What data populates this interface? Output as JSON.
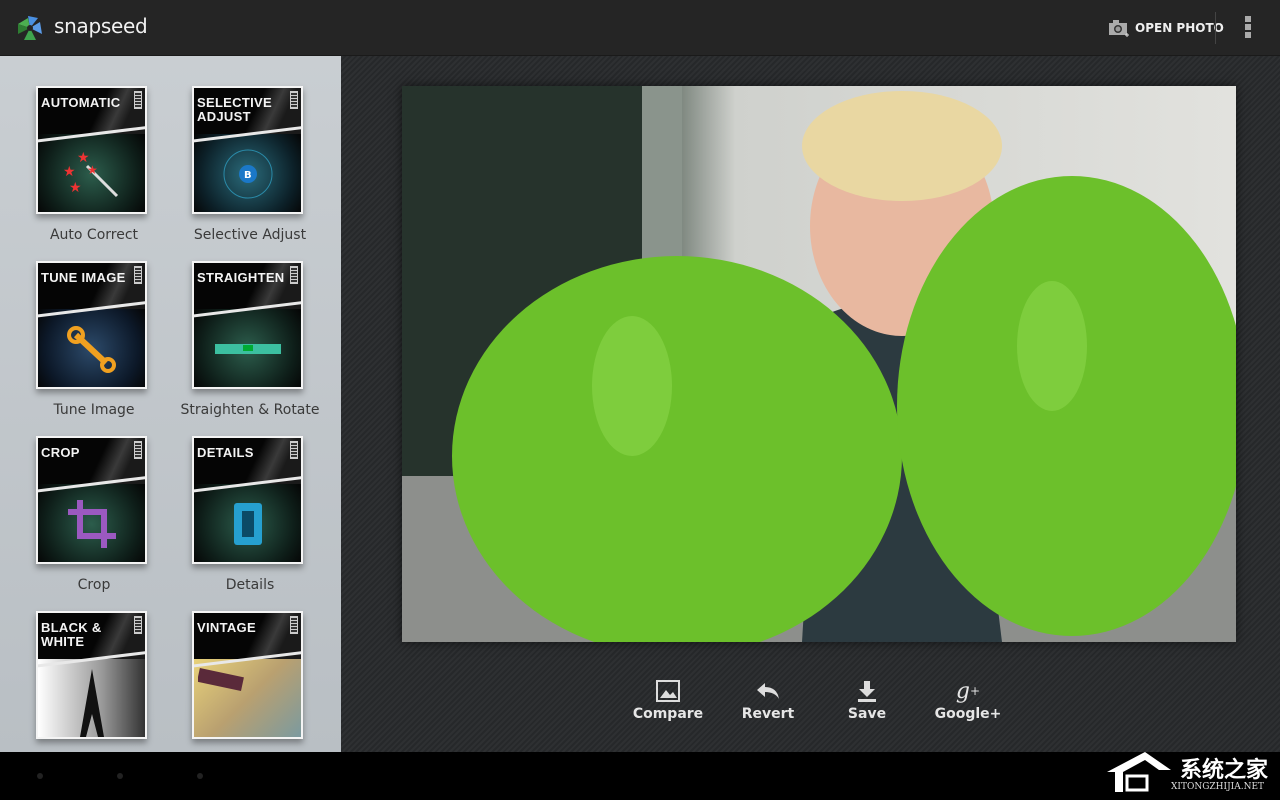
{
  "app": {
    "name": "snapseed"
  },
  "topbar": {
    "open_photo_label": "OPEN PHOTO"
  },
  "filters": [
    {
      "cover_title": "AUTOMATIC",
      "label": "Auto Correct"
    },
    {
      "cover_title": "SELECTIVE ADJUST",
      "label": "Selective Adjust"
    },
    {
      "cover_title": "TUNE IMAGE",
      "label": "Tune Image"
    },
    {
      "cover_title": "STRAIGHTEN",
      "label": "Straighten & Rotate"
    },
    {
      "cover_title": "CROP",
      "label": "Crop"
    },
    {
      "cover_title": "DETAILS",
      "label": "Details"
    },
    {
      "cover_title": "BLACK & WHITE",
      "label": ""
    },
    {
      "cover_title": "VINTAGE",
      "label": ""
    }
  ],
  "actions": {
    "compare": "Compare",
    "revert": "Revert",
    "save": "Save",
    "google_plus": "Google+"
  },
  "watermark": {
    "cn": "系统之家",
    "en": "XITONGZHIJIA.NET"
  },
  "colors": {
    "balloon": "#6fc22a",
    "topbar": "#252525"
  }
}
